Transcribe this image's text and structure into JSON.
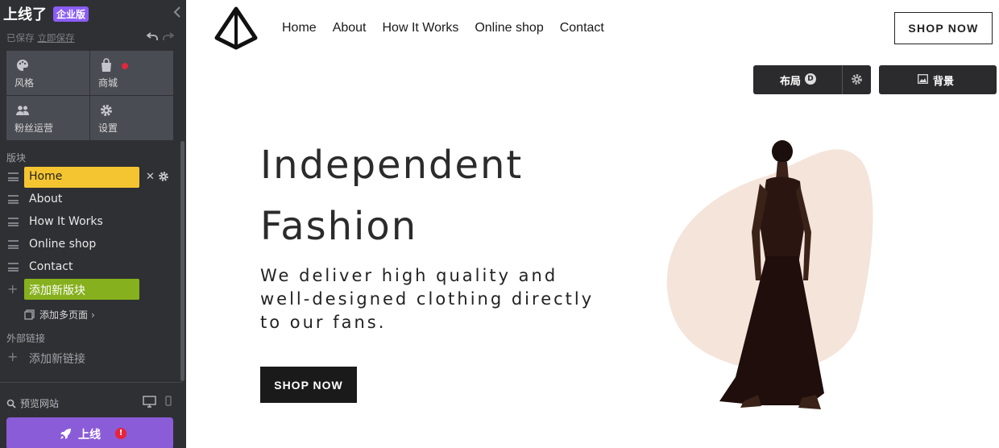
{
  "sidebar": {
    "brand": "上线了",
    "badge": "企业版",
    "save_status": "已保存",
    "save_now": "立即保存",
    "tiles": [
      {
        "label": "风格",
        "icon": "palette-icon"
      },
      {
        "label": "商城",
        "icon": "shopping-bag-icon"
      },
      {
        "label": "粉丝运营",
        "icon": "people-icon"
      },
      {
        "label": "设置",
        "icon": "gear-icon"
      }
    ],
    "blocks_heading": "版块",
    "blocks": [
      {
        "label": "Home",
        "active": true
      },
      {
        "label": "About"
      },
      {
        "label": "How It Works"
      },
      {
        "label": "Online shop"
      },
      {
        "label": "Contact"
      }
    ],
    "add_block": "添加新版块",
    "add_multipage": "添加多页面",
    "external_links_heading": "外部链接",
    "add_link": "添加新链接",
    "preview": "预览网站",
    "publish": "上线",
    "publish_warning": "!"
  },
  "site": {
    "nav": [
      "Home",
      "About",
      "How It Works",
      "Online shop",
      "Contact"
    ],
    "shop_now_top": "SHOP NOW",
    "tool_layout": "布局",
    "tool_layout_badge": "D",
    "tool_background": "背景",
    "hero": {
      "title_line1": "Independent",
      "title_line2": "Fashion",
      "subtitle": "We deliver high quality and well-designed clothing directly to our fans.",
      "cta": "SHOP NOW"
    }
  },
  "colors": {
    "sidebar_bg": "#2f3034",
    "tile_bg": "#4a4c53",
    "active_block": "#f5c531",
    "add_block": "#86b01d",
    "publish": "#8b5cd8",
    "brand_badge": "#8b5cf6"
  }
}
